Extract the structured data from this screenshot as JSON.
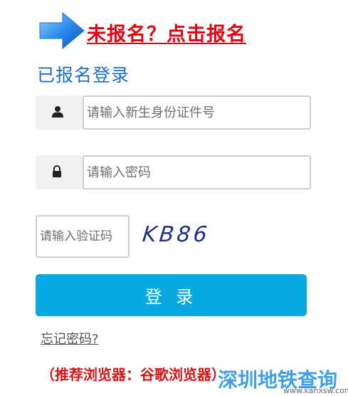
{
  "register_link": {
    "label": "未报名？点击报名",
    "color": "#e60012"
  },
  "arrow_icon": "blue-arrow-icon",
  "login_title": "已报名登录",
  "id_field": {
    "icon": "user-icon",
    "placeholder": "请输入新生身份证件号",
    "value": ""
  },
  "password_field": {
    "icon": "lock-icon",
    "placeholder": "请输入密码",
    "value": ""
  },
  "captcha_field": {
    "placeholder": "请输入验证码",
    "value": ""
  },
  "captcha_image_text": "KB86",
  "login_button": {
    "label": "登 录",
    "color": "#08a8e3"
  },
  "forgot_password": "忘记密码?",
  "browser_tip": "（推荐浏览器：谷歌浏览器）",
  "watermark": {
    "title": "深圳地铁查询",
    "url": "www.kanxsw.com"
  }
}
